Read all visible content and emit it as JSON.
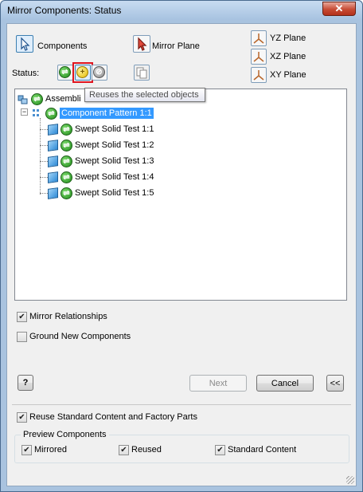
{
  "window": {
    "title": "Mirror Components: Status",
    "close_label": "✕"
  },
  "selectors": {
    "components_label": "Components",
    "mirror_plane_label": "Mirror Plane",
    "yz_plane_label": "YZ Plane",
    "xz_plane_label": "XZ Plane",
    "xy_plane_label": "XY Plane"
  },
  "status": {
    "label": "Status:",
    "tooltip": "Reuses the selected objects"
  },
  "tree": {
    "root_label": "Assembli",
    "pattern_label": "Component Pattern 1:1",
    "children": [
      "Swept Solid Test 1:1",
      "Swept Solid Test 1:2",
      "Swept Solid Test 1:3",
      "Swept Solid Test 1:4",
      "Swept Solid Test 1:5"
    ]
  },
  "options": {
    "mirror_relationships": {
      "label": "Mirror Relationships",
      "checked": true
    },
    "ground_new_components": {
      "label": "Ground New Components",
      "checked": false
    }
  },
  "buttons": {
    "help_label": "?",
    "next_label": "Next",
    "cancel_label": "Cancel",
    "collapse_label": "<<"
  },
  "reuse_standard": {
    "label": "Reuse Standard Content and Factory Parts",
    "checked": true
  },
  "preview": {
    "group_label": "Preview Components",
    "mirrored_label": "Mirrored",
    "reused_label": "Reused",
    "standard_content_label": "Standard Content"
  },
  "colors": {
    "selection": "#3399ff",
    "highlight_box": "#e0141e",
    "window_frame": "#a9c3df"
  }
}
